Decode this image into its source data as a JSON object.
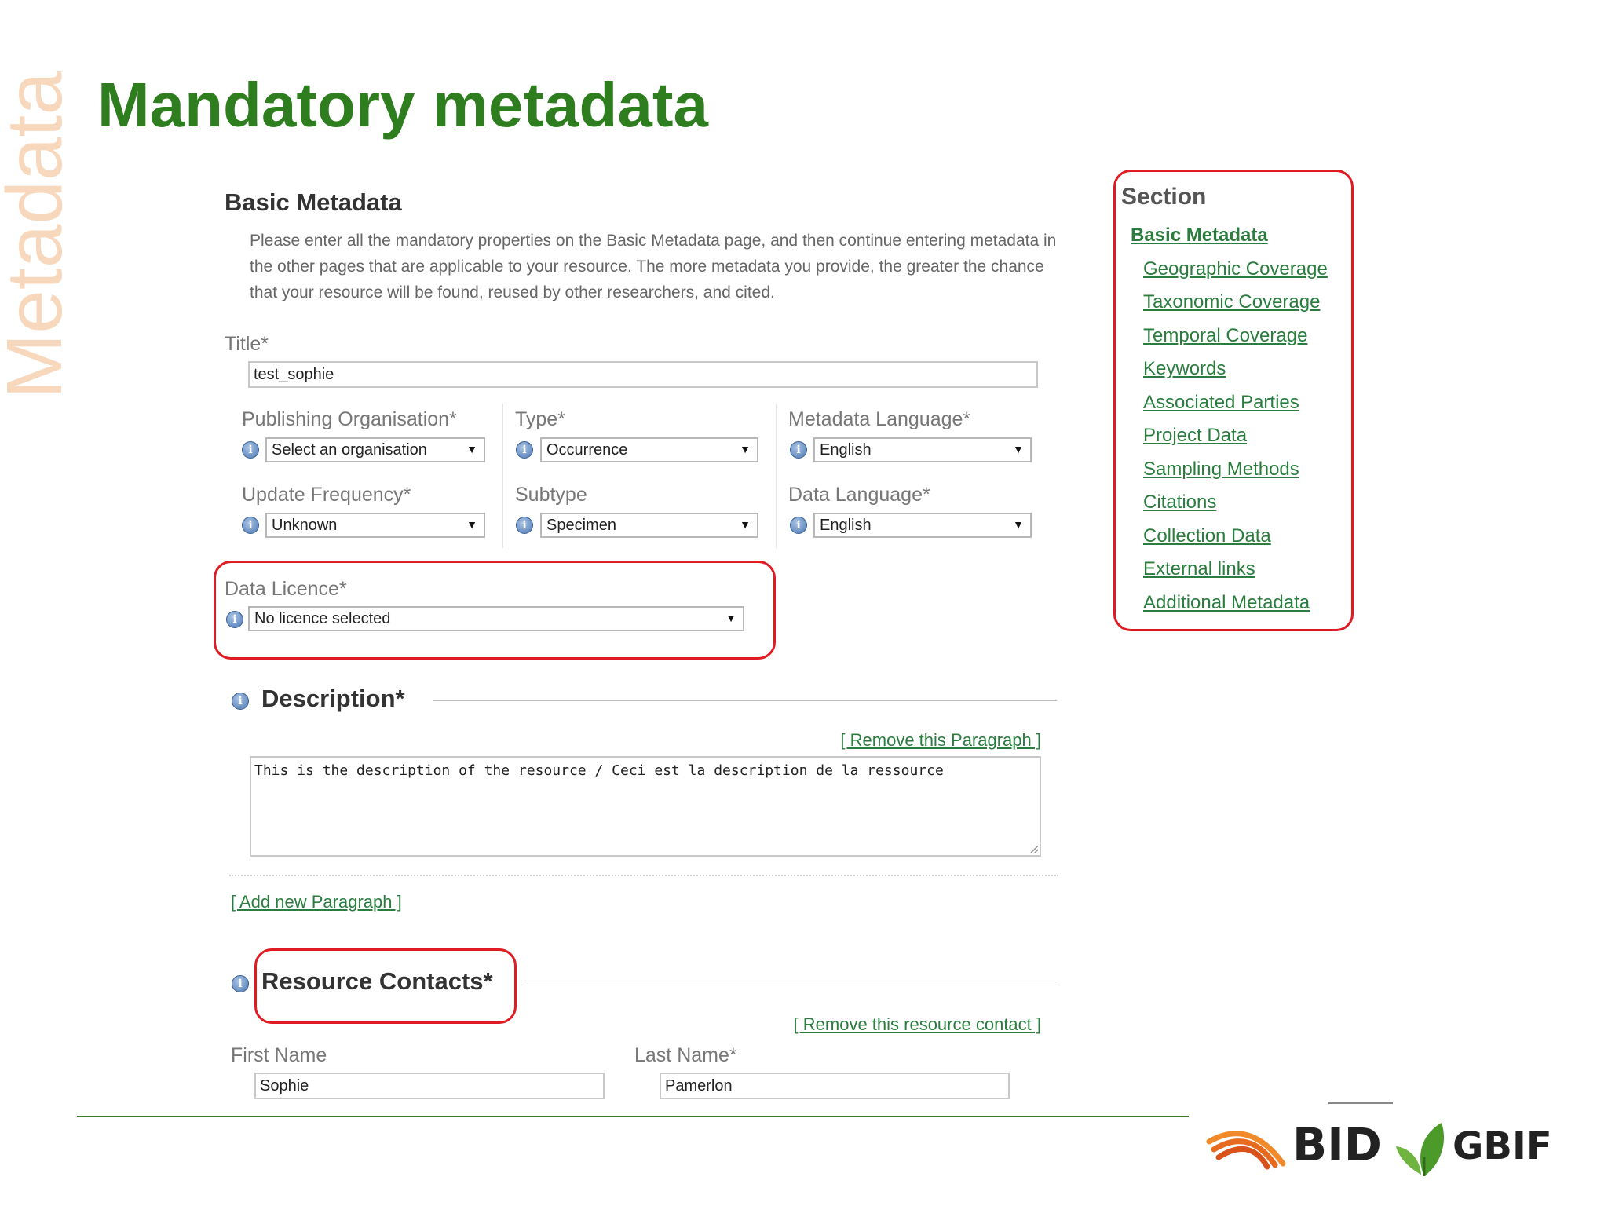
{
  "slide": {
    "side_word": "Metadata",
    "title": "Mandatory metadata"
  },
  "basic": {
    "heading": "Basic Metadata",
    "intro": "Please enter all the mandatory properties on the Basic Metadata page, and then continue entering metadata in the other pages that are applicable to your resource. The more metadata you provide, the greater the chance that your resource will be found, reused by other researchers, and cited.",
    "title_label": "Title*",
    "title_value": "test_sophie",
    "publishing_org_label": "Publishing Organisation*",
    "publishing_org_value": "Select an organisation",
    "type_label": "Type*",
    "type_value": "Occurrence",
    "metadata_lang_label": "Metadata Language*",
    "metadata_lang_value": "English",
    "update_freq_label": "Update Frequency*",
    "update_freq_value": "Unknown",
    "subtype_label": "Subtype",
    "subtype_value": "Specimen",
    "data_lang_label": "Data Language*",
    "data_lang_value": "English",
    "licence_label": "Data Licence*",
    "licence_value": "No licence selected"
  },
  "description": {
    "heading": "Description*",
    "remove_link": "[ Remove this Paragraph ]",
    "text": "This is the description of the resource / Ceci est la description de la ressource",
    "add_link": "[ Add new Paragraph ]"
  },
  "contacts": {
    "heading": "Resource Contacts*",
    "remove_link": "[ Remove this resource contact ]",
    "first_name_label": "First Name",
    "first_name_value": "Sophie",
    "last_name_label": "Last Name*",
    "last_name_value": "Pamerlon"
  },
  "nav": {
    "heading": "Section",
    "items": [
      "Basic Metadata",
      "Geographic Coverage",
      "Taxonomic Coverage",
      "Temporal Coverage",
      "Keywords",
      "Associated Parties",
      "Project Data",
      "Sampling Methods",
      "Citations",
      "Collection Data",
      "External links",
      "Additional Metadata"
    ]
  },
  "logos": {
    "bid": "BID",
    "gbif": "GBIF"
  },
  "colors": {
    "title_green": "#2e7d1f",
    "link_green": "#2a7d3e",
    "highlight_red": "#e01b24",
    "side_word": "#f8d8bd"
  },
  "icons": [
    "info-icon",
    "dropdown-arrow-icon",
    "bid-arcs-icon",
    "gbif-leaf-icon"
  ]
}
